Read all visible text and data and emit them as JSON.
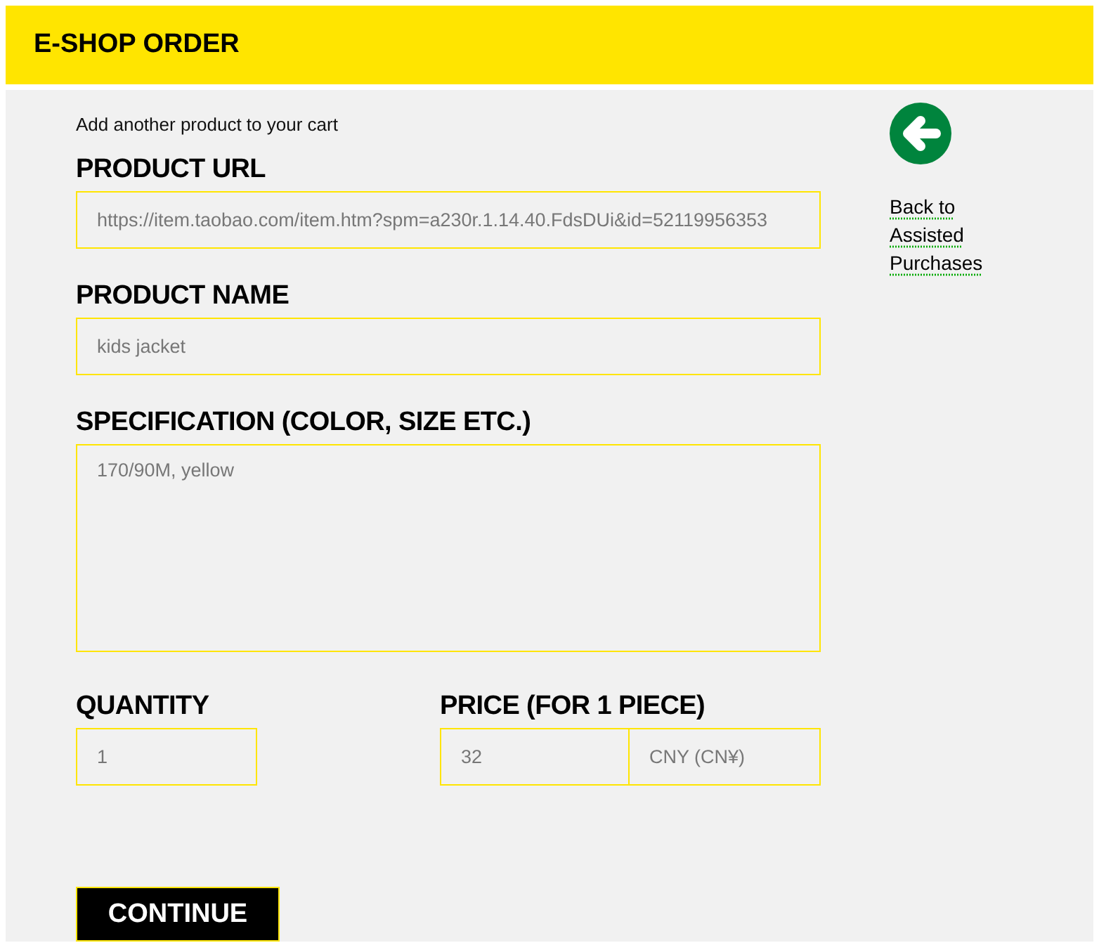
{
  "header": {
    "title": "E-SHOP ORDER"
  },
  "form": {
    "intro": "Add another product to your cart",
    "fields": [
      {
        "kind": "line",
        "label": "PRODUCT URL",
        "value": "https://item.taobao.com/item.htm?spm=a230r.1.14.40.FdsDUi&id=52119956353"
      },
      {
        "kind": "line",
        "label": "PRODUCT NAME",
        "value": "kids jacket"
      },
      {
        "kind": "area",
        "label": "SPECIFICATION (COLOR, SIZE ETC.)",
        "value": "170/90M, yellow"
      }
    ],
    "quantity": {
      "label": "QUANTITY",
      "value": "1"
    },
    "price": {
      "label": "PRICE (FOR 1 PIECE)",
      "value": "32",
      "currency": "CNY (CN¥)"
    },
    "button": "CONTINUE"
  },
  "sidebar": {
    "link": "Back to Assisted Purchases"
  }
}
